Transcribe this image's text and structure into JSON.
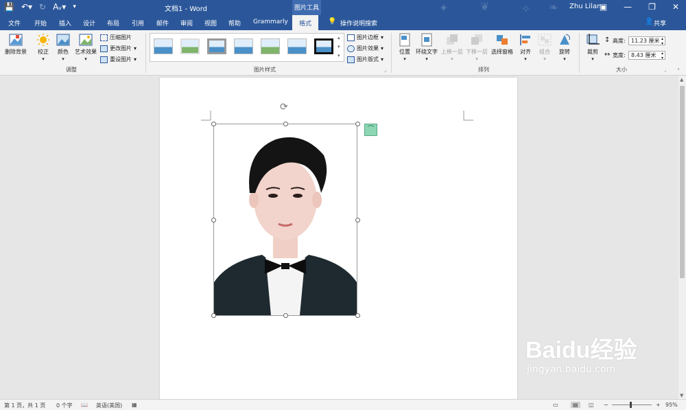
{
  "titlebar": {
    "title": "文档1  -  Word",
    "context_tool": "图片工具",
    "user": "Zhu Lilan",
    "qat_icons": [
      "save-icon",
      "undo-icon",
      "redo-icon",
      "spelling-icon",
      "customize-icon"
    ]
  },
  "tabs": [
    {
      "label": "文件"
    },
    {
      "label": "开始"
    },
    {
      "label": "插入"
    },
    {
      "label": "设计"
    },
    {
      "label": "布局"
    },
    {
      "label": "引用"
    },
    {
      "label": "邮件"
    },
    {
      "label": "审阅"
    },
    {
      "label": "视图"
    },
    {
      "label": "帮助"
    },
    {
      "label": "Grammarly"
    },
    {
      "label": "格式"
    }
  ],
  "search_hint": "操作说明搜索",
  "share": "共享",
  "ribbon": {
    "adjust": {
      "label": "调整",
      "remove_bg": "删除背景",
      "correct": "校正",
      "color": "颜色",
      "artistic": "艺术效果",
      "compress": "压缩图片",
      "change": "更改图片",
      "reset": "重设图片"
    },
    "styles": {
      "label": "图片样式",
      "border": "图片边框",
      "effects": "图片效果",
      "layout": "图片版式"
    },
    "arrange": {
      "label": "排列",
      "position": "位置",
      "wrap": "环绕文字",
      "forward": "上移一层",
      "backward": "下移一层",
      "selection": "选择窗格",
      "align": "对齐",
      "group": "组合",
      "rotate": "旋转"
    },
    "size": {
      "label": "大小",
      "crop": "裁剪",
      "height_label": "高度:",
      "height_value": "11.23 厘米",
      "width_label": "宽度:",
      "width_value": "8.43 厘米"
    }
  },
  "statusbar": {
    "page": "第 1 页，共 1 页",
    "words": "0 个字",
    "language": "英语(美国)",
    "zoom": "95%"
  },
  "watermark": {
    "brand": "Baidu经验",
    "url": "jingyan.baidu.com"
  },
  "colors": {
    "titlebar": "#2b579a",
    "ribbon": "#f3f3f3",
    "suit": "#1f2a30",
    "hair": "#141414",
    "skin": "#f2d4cc"
  }
}
